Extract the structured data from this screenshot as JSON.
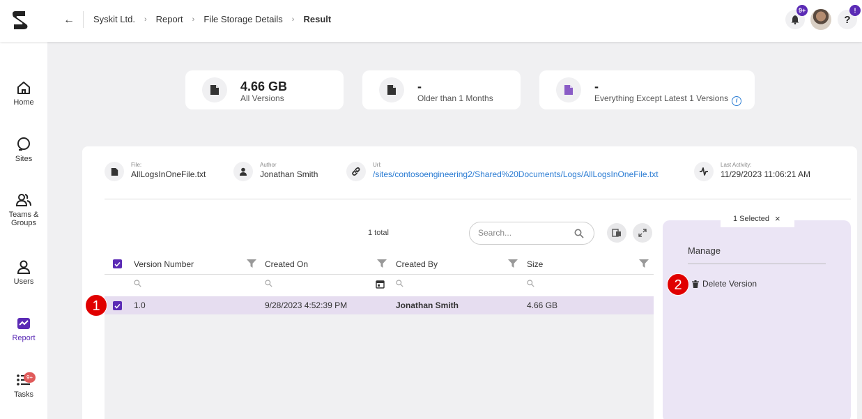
{
  "breadcrumb": {
    "items": [
      "Syskit Ltd.",
      "Report",
      "File Storage Details"
    ],
    "current": "Result"
  },
  "topbar": {
    "notifications_badge": "9+",
    "help_badge": "!"
  },
  "sidebar": {
    "items": [
      {
        "label": "Home",
        "icon": "home-icon"
      },
      {
        "label": "Sites",
        "icon": "sites-icon"
      },
      {
        "label": "Teams &",
        "label2": "Groups",
        "icon": "teams-icon"
      },
      {
        "label": "Users",
        "icon": "user-icon"
      },
      {
        "label": "Report",
        "icon": "report-icon",
        "active": true
      },
      {
        "label": "Tasks",
        "icon": "tasks-icon",
        "badge": "9+"
      }
    ]
  },
  "stats": [
    {
      "value": "4.66 GB",
      "label": "All Versions"
    },
    {
      "value": "-",
      "label": "Older than 1 Months"
    },
    {
      "value": "-",
      "label": "Everything Except Latest 1 Versions"
    }
  ],
  "file_meta": {
    "file": {
      "label": "File:",
      "value": "AllLogsInOneFile.txt"
    },
    "author": {
      "label": "Author",
      "value": "Jonathan Smith"
    },
    "url": {
      "label": "Url:",
      "value": "/sites/contosoengineering2/Shared%20Documents/Logs/AllLogsInOneFile.txt"
    },
    "activity": {
      "label": "Last Activity:",
      "value": "11/29/2023 11:06:21 AM"
    }
  },
  "grid": {
    "total": "1 total",
    "search_placeholder": "Search...",
    "columns": [
      "Version Number",
      "Created On",
      "Created By",
      "Size"
    ],
    "rows": [
      {
        "version": "1.0",
        "created_on": "9/28/2023 4:52:39 PM",
        "created_by": "Jonathan Smith",
        "size": "4.66 GB",
        "selected": true
      }
    ]
  },
  "side_panel": {
    "selected_text": "1 Selected",
    "close": "×",
    "manage_title": "Manage",
    "delete_label": "Delete Version"
  },
  "callouts": [
    "1",
    "2"
  ],
  "colors": {
    "accent": "#5b2bb5",
    "link": "#2b7cd3",
    "callout": "#e00000",
    "selected_row": "#e6ddf0"
  }
}
